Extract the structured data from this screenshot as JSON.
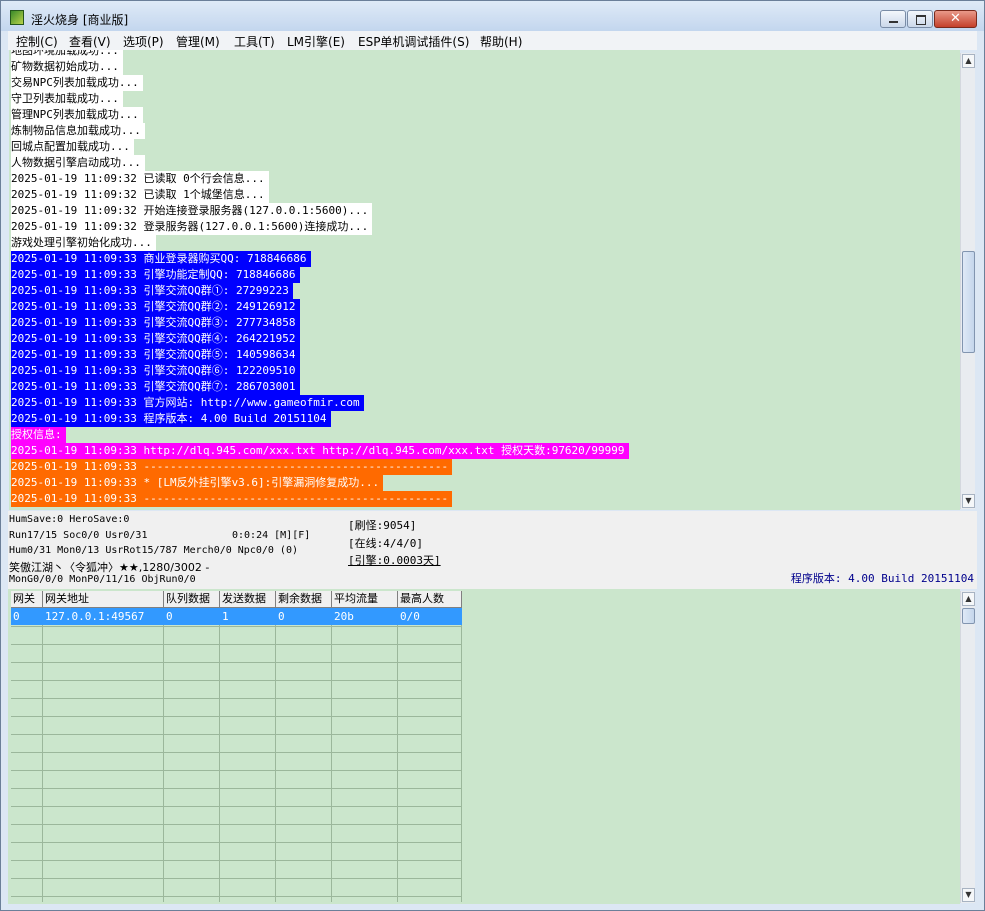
{
  "window": {
    "title": "淫火烧身 [商业版]",
    "close_glyph": "✕"
  },
  "menu": [
    "控制(C)",
    "查看(V)",
    "选项(P)",
    "管理(M)",
    "工具(T)",
    "LM引擎(E)",
    "ESP单机调试插件(S)",
    "帮助(H)"
  ],
  "log": {
    "lines": [
      {
        "text": "地图环境加载成功...",
        "style": "plain"
      },
      {
        "text": "矿物数据初始成功...",
        "style": "plain"
      },
      {
        "text": "交易NPC列表加载成功...",
        "style": "plain"
      },
      {
        "text": "守卫列表加载成功...",
        "style": "plain"
      },
      {
        "text": "管理NPC列表加载成功...",
        "style": "plain"
      },
      {
        "text": "炼制物品信息加载成功...",
        "style": "plain"
      },
      {
        "text": "回城点配置加载成功...",
        "style": "plain"
      },
      {
        "text": "人物数据引擎启动成功...",
        "style": "plain"
      },
      {
        "text": "2025-01-19 11:09:32 已读取 0个行会信息...",
        "style": "plain"
      },
      {
        "text": "2025-01-19 11:09:32 已读取 1个城堡信息...",
        "style": "plain"
      },
      {
        "text": "2025-01-19 11:09:32 开始连接登录服务器(127.0.0.1:5600)...",
        "style": "plain"
      },
      {
        "text": "2025-01-19 11:09:32 登录服务器(127.0.0.1:5600)连接成功...",
        "style": "plain"
      },
      {
        "text": "游戏处理引擎初始化成功...",
        "style": "plain"
      },
      {
        "text": "2025-01-19 11:09:33 商业登录器购买QQ: 718846686",
        "style": "blue"
      },
      {
        "text": "2025-01-19 11:09:33 引擎功能定制QQ: 718846686",
        "style": "blue"
      },
      {
        "text": "2025-01-19 11:09:33 引擎交流QQ群①: 27299223",
        "style": "blue"
      },
      {
        "text": "2025-01-19 11:09:33 引擎交流QQ群②: 249126912",
        "style": "blue"
      },
      {
        "text": "2025-01-19 11:09:33 引擎交流QQ群③: 277734858",
        "style": "blue"
      },
      {
        "text": "2025-01-19 11:09:33 引擎交流QQ群④: 264221952",
        "style": "blue"
      },
      {
        "text": "2025-01-19 11:09:33 引擎交流QQ群⑤: 140598634",
        "style": "blue"
      },
      {
        "text": "2025-01-19 11:09:33 引擎交流QQ群⑥: 122209510",
        "style": "blue"
      },
      {
        "text": "2025-01-19 11:09:33 引擎交流QQ群⑦: 286703001",
        "style": "blue"
      },
      {
        "text": "2025-01-19 11:09:33 官方网站: http://www.gameofmir.com",
        "style": "blue"
      },
      {
        "text": "2025-01-19 11:09:33 程序版本: 4.00 Build 20151104",
        "style": "blue"
      },
      {
        "text": "授权信息:",
        "style": "magenta"
      },
      {
        "text": "2025-01-19 11:09:33 http://dlq.945.com/xxx.txt http://dlq.945.com/xxx.txt 授权天数:97620/99999",
        "style": "magenta"
      },
      {
        "text": "2025-01-19 11:09:33 ----------------------------------------------",
        "style": "orange"
      },
      {
        "text": "2025-01-19 11:09:33 * [LM反外挂引擎v3.6]:引擎漏洞修复成功...",
        "style": "orange"
      },
      {
        "text": "2025-01-19 11:09:33 ----------------------------------------------",
        "style": "orange"
      }
    ]
  },
  "status": {
    "save": "HumSave:0 HeroSave:0",
    "run": "Run17/15 Soc0/0 Usr0/31",
    "time": "0:0:24 [M][F]",
    "hum": "Hum0/31 Mon0/13 UsrRot15/787 Merch0/0 Npc0/0 (0)",
    "player": "笑傲江湖丶〈令狐冲〉★★,1280/3002 -",
    "mongo": "MonG0/0/0 MonP0/11/16 ObjRun0/0",
    "refresh": "[刷怪:9054]",
    "online": "[在线:4/4/0]",
    "engine": "[引擎:0.0003天]",
    "version": "程序版本: 4.00 Build 20151104"
  },
  "grid": {
    "headers": [
      "网关",
      "网关地址",
      "队列数据",
      "发送数据",
      "剩余数据",
      "平均流量",
      "最高人数"
    ],
    "rows": [
      [
        "0",
        "127.0.0.1:49567",
        "0",
        "1",
        "0",
        "20b",
        "0/0"
      ]
    ]
  },
  "colors": {
    "blue": "#0000ff",
    "magenta": "#ff00ff",
    "orange": "#ff6a00",
    "log_bg": "#cbe6cc",
    "selection": "#3299ff"
  }
}
